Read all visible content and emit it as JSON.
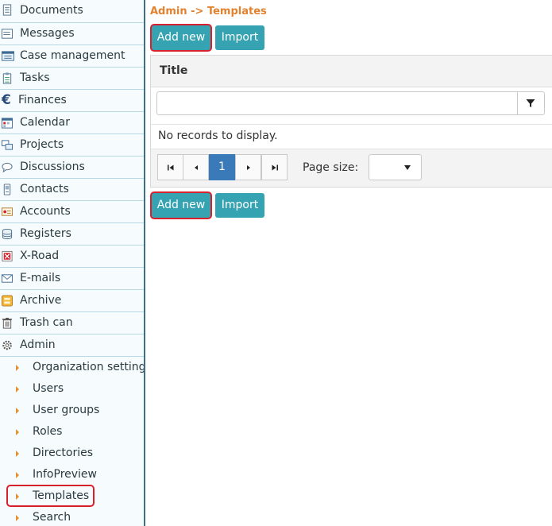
{
  "sidebar": {
    "items": [
      {
        "label": "Documents",
        "icon": "document-icon"
      },
      {
        "label": "Messages",
        "icon": "message-icon"
      },
      {
        "label": "Case management",
        "icon": "case-management-icon"
      },
      {
        "label": "Tasks",
        "icon": "tasks-icon"
      },
      {
        "label": "Finances",
        "icon": "euro-icon"
      },
      {
        "label": "Calendar",
        "icon": "calendar-icon"
      },
      {
        "label": "Projects",
        "icon": "projects-icon"
      },
      {
        "label": "Discussions",
        "icon": "discussion-icon"
      },
      {
        "label": "Contacts",
        "icon": "contacts-icon"
      },
      {
        "label": "Accounts",
        "icon": "accounts-icon"
      },
      {
        "label": "Registers",
        "icon": "database-icon"
      },
      {
        "label": "X-Road",
        "icon": "x-road-icon"
      },
      {
        "label": "E-mails",
        "icon": "envelope-icon"
      },
      {
        "label": "Archive",
        "icon": "archive-icon"
      },
      {
        "label": "Trash can",
        "icon": "trash-icon"
      },
      {
        "label": "Admin",
        "icon": "gear-icon"
      }
    ],
    "admin_subitems": [
      {
        "label": "Organization settings"
      },
      {
        "label": "Users"
      },
      {
        "label": "User groups"
      },
      {
        "label": "Roles"
      },
      {
        "label": "Directories"
      },
      {
        "label": "InfoPreview"
      },
      {
        "label": "Templates",
        "active": true
      },
      {
        "label": "Search"
      }
    ]
  },
  "breadcrumb": "Admin -> Templates",
  "toolbar": {
    "add_new_label": "Add new",
    "import_label": "Import"
  },
  "grid": {
    "column_title": "Title",
    "filter_value": "",
    "empty_message": "No records to display.",
    "pager": {
      "current_page": "1",
      "page_size_label": "Page size:",
      "page_size_value": ""
    }
  },
  "colors": {
    "accent": "#36a3b3",
    "breadcrumb": "#e3822e",
    "highlight": "#d9212e",
    "active_page": "#3a7ab8"
  }
}
